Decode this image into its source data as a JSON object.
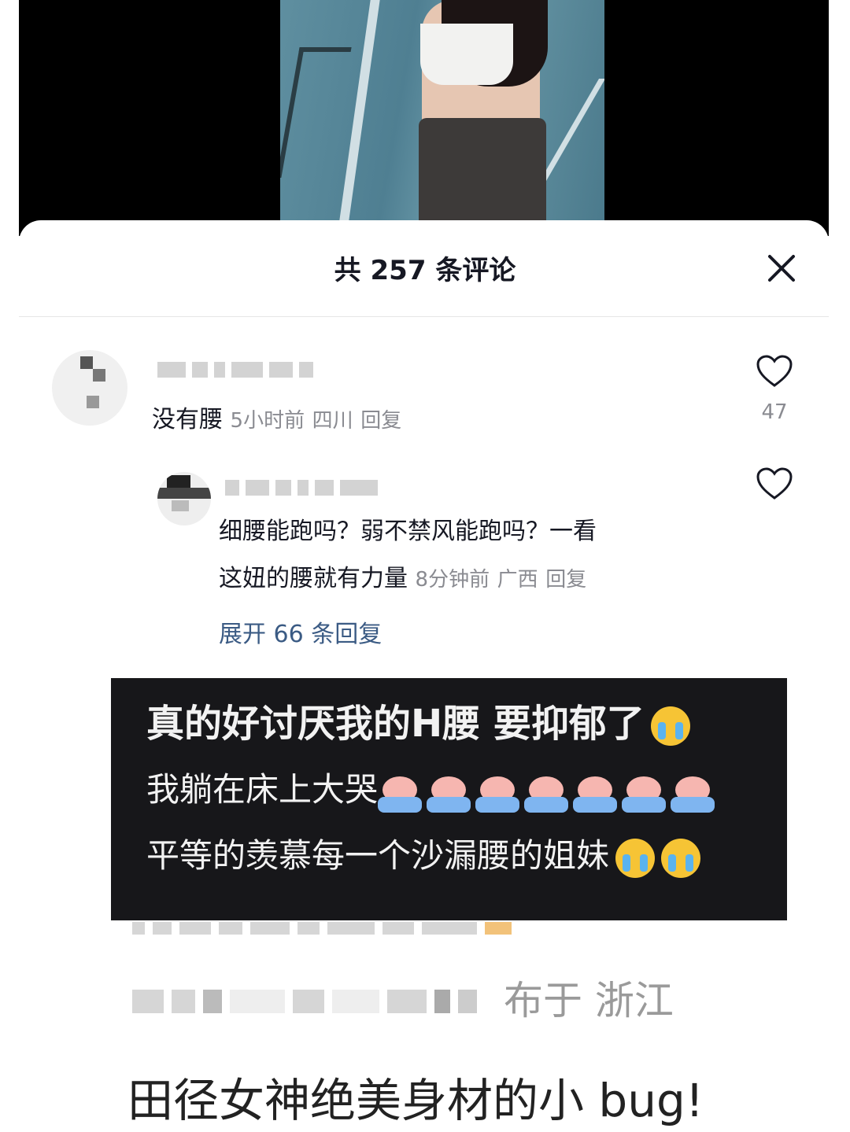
{
  "header": {
    "title": "共 257 条评论"
  },
  "comments": [
    {
      "text": "没有腰",
      "time": "5小时前",
      "location": "四川",
      "reply_label": "回复",
      "likes": "47"
    }
  ],
  "reply": {
    "line1": "细腰能跑吗？弱不禁风能跑吗？一看",
    "line2": "这妞的腰就有力量",
    "time": "8分钟前",
    "location": "广西",
    "reply_label": "回复",
    "expand_label": "展开 66 条回复"
  },
  "overlay_post": {
    "line1": "真的好讨厌我的H腰 要抑郁了",
    "line2": "我躺在床上大哭",
    "line3": "平等的羡慕每一个沙漏腰的姐妹"
  },
  "publish_info": "布于 浙江",
  "caption": "田径女神绝美身材的小 bug!",
  "icons": {
    "close": "close-icon",
    "like": "heart-outline-icon",
    "emoji_cry": "loudly-crying-face-emoji",
    "emoji_pig": "crying-pig-in-tub-emoji"
  },
  "colors": {
    "link": "#3b5b84",
    "meta": "#8a8b91",
    "overlay_bg": "#17171a"
  }
}
